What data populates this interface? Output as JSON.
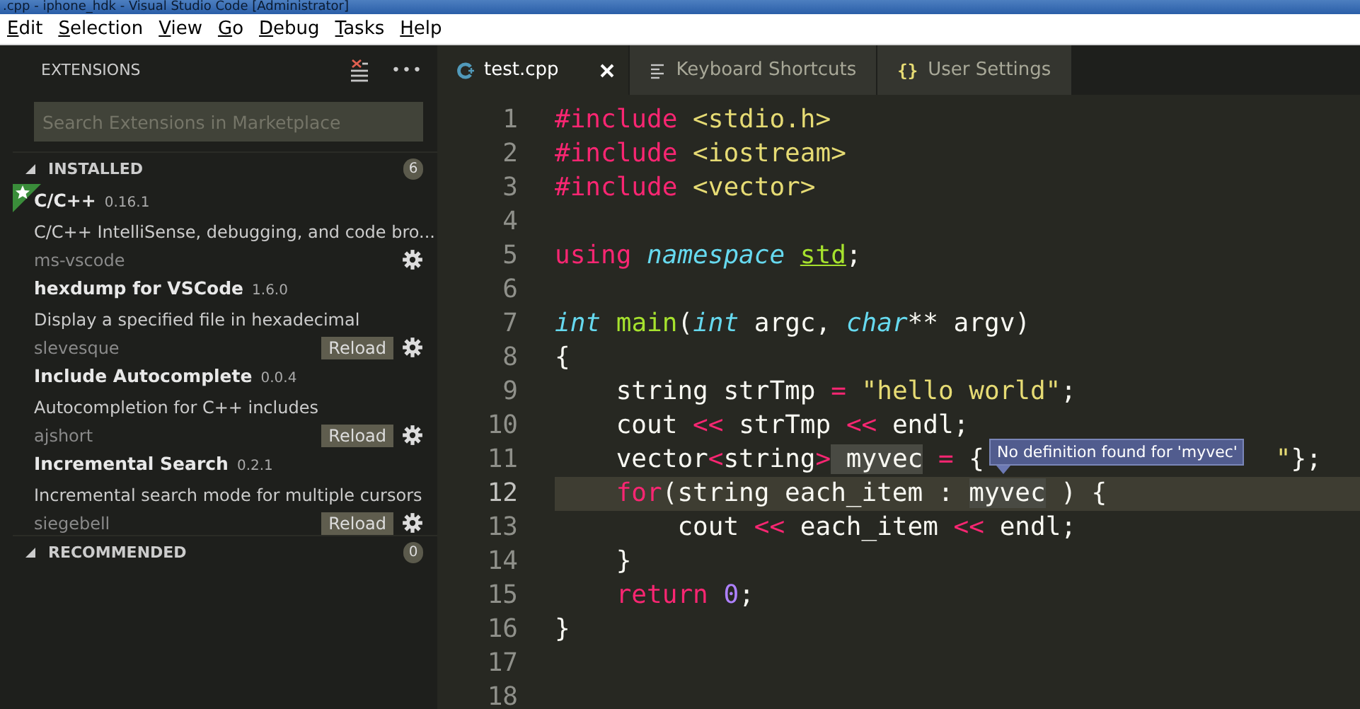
{
  "window": {
    "title": ".cpp - iphone_hdk - Visual Studio Code [Administrator]"
  },
  "menu": [
    "Edit",
    "Selection",
    "View",
    "Go",
    "Debug",
    "Tasks",
    "Help"
  ],
  "sidebar": {
    "title": "EXTENSIONS",
    "more": "•••",
    "search": {
      "placeholder": "Search Extensions in Marketplace"
    },
    "sections": [
      {
        "label": "INSTALLED",
        "count": "6",
        "expanded": true,
        "items": [
          {
            "name": "C/C++",
            "version": "0.16.1",
            "description": "C/C++ IntelliSense, debugging, and code bro...",
            "publisher": "ms-vscode",
            "starred": true,
            "reload": false
          },
          {
            "name": "hexdump for VSCode",
            "version": "1.6.0",
            "description": "Display a specified file in hexadecimal",
            "publisher": "slevesque",
            "starred": false,
            "reload": true,
            "reload_label": "Reload"
          },
          {
            "name": "Include Autocomplete",
            "version": "0.0.4",
            "description": "Autocompletion for C++ includes",
            "publisher": "ajshort",
            "starred": false,
            "reload": true,
            "reload_label": "Reload"
          },
          {
            "name": "Incremental Search",
            "version": "0.2.1",
            "description": "Incremental search mode for multiple cursors",
            "publisher": "siegebell",
            "starred": false,
            "reload": true,
            "reload_label": "Reload"
          }
        ]
      },
      {
        "label": "RECOMMENDED",
        "count": "0",
        "expanded": true
      }
    ]
  },
  "tabs": [
    {
      "label": "test.cpp",
      "kind": "cpp",
      "selected": true
    },
    {
      "label": "Keyboard Shortcuts",
      "kind": "lines",
      "selected": false
    },
    {
      "label": "User Settings",
      "kind": "braces",
      "icon_text": "{}",
      "selected": false
    }
  ],
  "editor": {
    "tooltip": "No definition found for 'myvec'",
    "lines": [
      {
        "number": "1",
        "current": false,
        "tokens": [
          {
            "text": "#include",
            "kind": "kw"
          },
          {
            "text": " <stdio.h>",
            "kind": "str"
          }
        ]
      },
      {
        "number": "2",
        "current": false,
        "tokens": [
          {
            "text": "#include",
            "kind": "kw"
          },
          {
            "text": " <iostream>",
            "kind": "str"
          }
        ]
      },
      {
        "number": "3",
        "current": false,
        "tokens": [
          {
            "text": "#include",
            "kind": "kw"
          },
          {
            "text": " <vector>",
            "kind": "str"
          }
        ]
      },
      {
        "number": "4",
        "current": false
      },
      {
        "number": "5",
        "current": false,
        "tokens": [
          {
            "text": "using ",
            "kind": "kw"
          },
          {
            "text": "namespace ",
            "kind": "type"
          },
          {
            "text": "std",
            "kind": "fnu"
          },
          {
            "text": ";",
            "kind": "plain"
          }
        ]
      },
      {
        "number": "6",
        "current": false
      },
      {
        "number": "7",
        "current": false,
        "tokens": [
          {
            "text": "int ",
            "kind": "type"
          },
          {
            "text": "main",
            "kind": "fn"
          },
          {
            "text": "(",
            "kind": "plain"
          },
          {
            "text": "int",
            "kind": "type"
          },
          {
            "text": " argc, ",
            "kind": "plain"
          },
          {
            "text": "char",
            "kind": "type"
          },
          {
            "text": "** argv)",
            "kind": "plain"
          }
        ]
      },
      {
        "number": "8",
        "current": false,
        "tokens": [
          {
            "text": "{",
            "kind": "plain"
          }
        ]
      },
      {
        "number": "9",
        "current": false,
        "tokens": [
          {
            "text": "    string strTmp ",
            "kind": "plain"
          },
          {
            "text": "= ",
            "kind": "kw"
          },
          {
            "text": "\"hello world\"",
            "kind": "str"
          },
          {
            "text": ";",
            "kind": "plain"
          }
        ]
      },
      {
        "number": "10",
        "current": false,
        "tokens": [
          {
            "text": "    cout ",
            "kind": "plain"
          },
          {
            "text": "<<",
            "kind": "kw"
          },
          {
            "text": " strTmp ",
            "kind": "plain"
          },
          {
            "text": "<<",
            "kind": "kw"
          },
          {
            "text": " endl;",
            "kind": "plain"
          }
        ]
      },
      {
        "number": "11",
        "current": false,
        "hover": true,
        "tokens": [
          {
            "text": "    vector",
            "kind": "plain"
          },
          {
            "text": "<",
            "kind": "kw"
          },
          {
            "text": "string",
            "kind": "plain"
          },
          {
            "text": ">",
            "kind": "kw"
          },
          {
            "text": " myvec",
            "kind": "plain",
            "highlight": true
          },
          {
            "text": " = ",
            "kind": "kw"
          },
          {
            "text": "{",
            "kind": "plain"
          },
          {
            "kind": "covered"
          },
          {
            "text": "\"",
            "kind": "str"
          },
          {
            "text": "};",
            "kind": "plain"
          }
        ]
      },
      {
        "number": "12",
        "current": true,
        "tokens": [
          {
            "text": "    for",
            "kind": "kw"
          },
          {
            "text": "(string each_item : ",
            "kind": "plain"
          },
          {
            "text": "myvec",
            "kind": "plain",
            "highlight": true
          },
          {
            "text": " ) {",
            "kind": "plain"
          }
        ]
      },
      {
        "number": "13",
        "current": false,
        "tokens": [
          {
            "text": "        cout ",
            "kind": "plain"
          },
          {
            "text": "<<",
            "kind": "kw"
          },
          {
            "text": " each_item ",
            "kind": "plain"
          },
          {
            "text": "<<",
            "kind": "kw"
          },
          {
            "text": " endl;",
            "kind": "plain"
          }
        ]
      },
      {
        "number": "14",
        "current": false,
        "tokens": [
          {
            "text": "    }",
            "kind": "plain"
          }
        ]
      },
      {
        "number": "15",
        "current": false,
        "tokens": [
          {
            "text": "    return ",
            "kind": "kw"
          },
          {
            "text": "0",
            "kind": "num"
          },
          {
            "text": ";",
            "kind": "plain"
          }
        ]
      },
      {
        "number": "16",
        "current": false,
        "tokens": [
          {
            "text": "}",
            "kind": "plain"
          }
        ]
      },
      {
        "number": "17",
        "current": false
      },
      {
        "number": "18",
        "current": false
      }
    ]
  }
}
